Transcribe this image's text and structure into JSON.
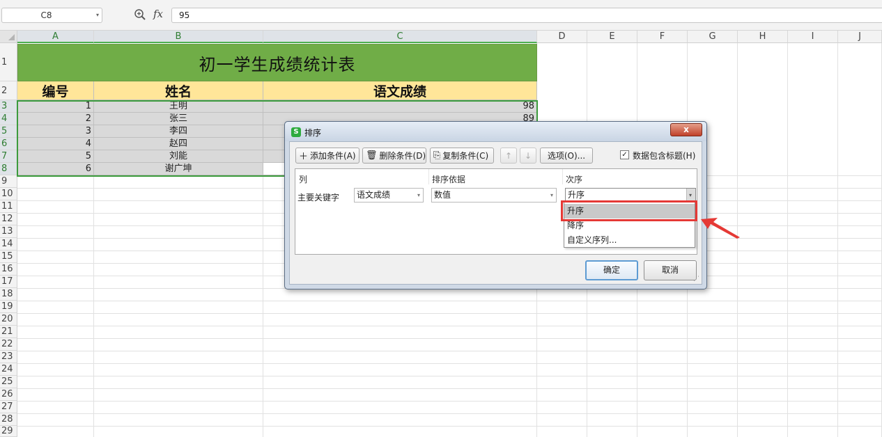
{
  "formula_bar": {
    "name_box": "C8",
    "fx_label": "fx",
    "formula": "95",
    "zoom_icon": "zoom-icon"
  },
  "columns": [
    "A",
    "B",
    "C",
    "D",
    "E",
    "F",
    "G",
    "H",
    "I",
    "J"
  ],
  "selected_columns": [
    "A",
    "B",
    "C"
  ],
  "rows": [
    "1",
    "2",
    "3",
    "4",
    "5",
    "6",
    "7",
    "8",
    "9",
    "10",
    "11",
    "12",
    "13",
    "14",
    "15",
    "16",
    "17",
    "18",
    "19",
    "20",
    "21",
    "22",
    "23",
    "24",
    "25",
    "26",
    "27",
    "28",
    "29"
  ],
  "selected_rows": [
    "3",
    "4",
    "5",
    "6",
    "7",
    "8"
  ],
  "sheet": {
    "title": "初一学生成绩统计表",
    "headers": [
      "编号",
      "姓名",
      "语文成绩"
    ],
    "data": [
      [
        "1",
        "王明",
        "98"
      ],
      [
        "2",
        "张三",
        "89"
      ],
      [
        "3",
        "李四",
        ""
      ],
      [
        "4",
        "赵四",
        ""
      ],
      [
        "5",
        "刘能",
        ""
      ],
      [
        "6",
        "谢广坤",
        ""
      ]
    ]
  },
  "dialog": {
    "title": "排序",
    "logo": "S",
    "close": "x",
    "toolbar": {
      "add": "添加条件(A)",
      "delete": "删除条件(D)",
      "copy": "复制条件(C)",
      "up": "↑",
      "down": "↓",
      "options": "选项(O)...",
      "has_header_checked": "✓",
      "has_header": "数据包含标题(H)"
    },
    "columns_header": {
      "col": "列",
      "basis": "排序依据",
      "order": "次序"
    },
    "condition": {
      "key_label": "主要关键字",
      "column": "语文成绩",
      "basis": "数值",
      "order": "升序"
    },
    "order_options": [
      "升序",
      "降序",
      "自定义序列..."
    ],
    "ok": "确定",
    "cancel": "取消"
  },
  "colors": {
    "title_band": "#70ad47",
    "header_band": "#ffe699",
    "selection": "#3c9b3c",
    "highlight": "#e53935"
  }
}
